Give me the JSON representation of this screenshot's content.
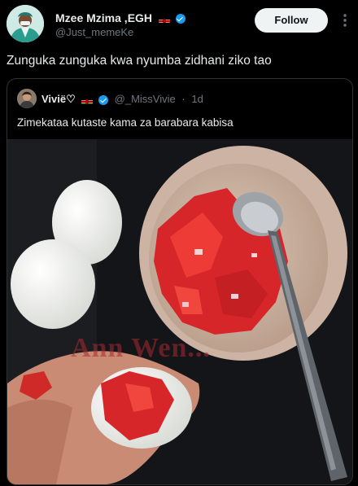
{
  "post": {
    "author_name": "Mzee Mzima ,EGH",
    "author_handle": "@Just_memeKe",
    "follow_label": "Follow",
    "text": "Zunguka zunguka kwa nyumba zidhani ziko tao"
  },
  "quote": {
    "author_name": "Viviё♡",
    "author_handle": "@_MissVivie",
    "separator": "·",
    "time": "1d",
    "text": "Zimekataa kutaste kama za barabara kabisa",
    "watermark": "Ann Wen..."
  },
  "colors": {
    "background": "#000000",
    "text_primary": "#e7e9ea",
    "text_secondary": "#71767b",
    "verified_blue": "#1d9bf0",
    "follow_bg": "#eff3f4",
    "border": "#2f3336"
  },
  "icons": [
    "kenya-flag-icon",
    "verified-badge-icon",
    "more-options-icon"
  ]
}
